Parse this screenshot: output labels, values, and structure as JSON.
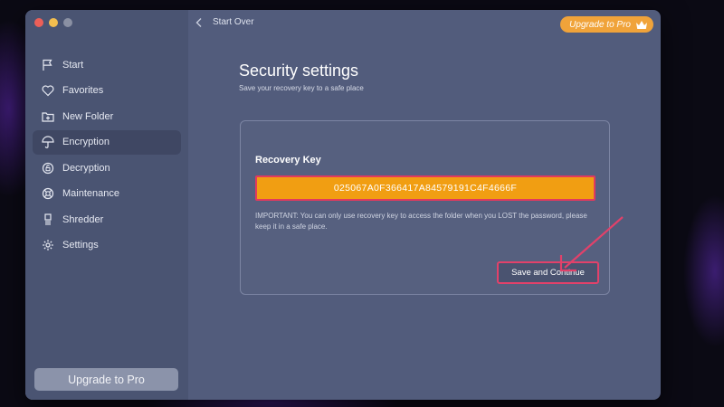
{
  "window": {
    "back_label": "Start Over",
    "upgrade_top_label": "Upgrade to Pro",
    "upgrade_side_label": "Upgrade to Pro"
  },
  "sidebar": {
    "items": [
      {
        "label": "Start",
        "icon": "flag-icon"
      },
      {
        "label": "Favorites",
        "icon": "heart-icon"
      },
      {
        "label": "New Folder",
        "icon": "folder-plus-icon"
      },
      {
        "label": "Encryption",
        "icon": "umbrella-icon",
        "active": true
      },
      {
        "label": "Decryption",
        "icon": "unlock-ring-icon"
      },
      {
        "label": "Maintenance",
        "icon": "lifebuoy-icon"
      },
      {
        "label": "Shredder",
        "icon": "shredder-icon"
      },
      {
        "label": "Settings",
        "icon": "gear-icon"
      }
    ]
  },
  "main": {
    "title": "Security settings",
    "subtitle": "Save your recovery key to a safe place",
    "card": {
      "label": "Recovery Key",
      "key": "025067A0F366417A84579191C4F4666F",
      "important": "IMPORTANT: You can only use recovery key to access the folder when you LOST the password, please keep it in a safe place.",
      "save_label": "Save and Continue"
    }
  },
  "colors": {
    "accent": "#f19e12",
    "highlight": "#e2416a",
    "upgrade": "#f0a33a"
  }
}
